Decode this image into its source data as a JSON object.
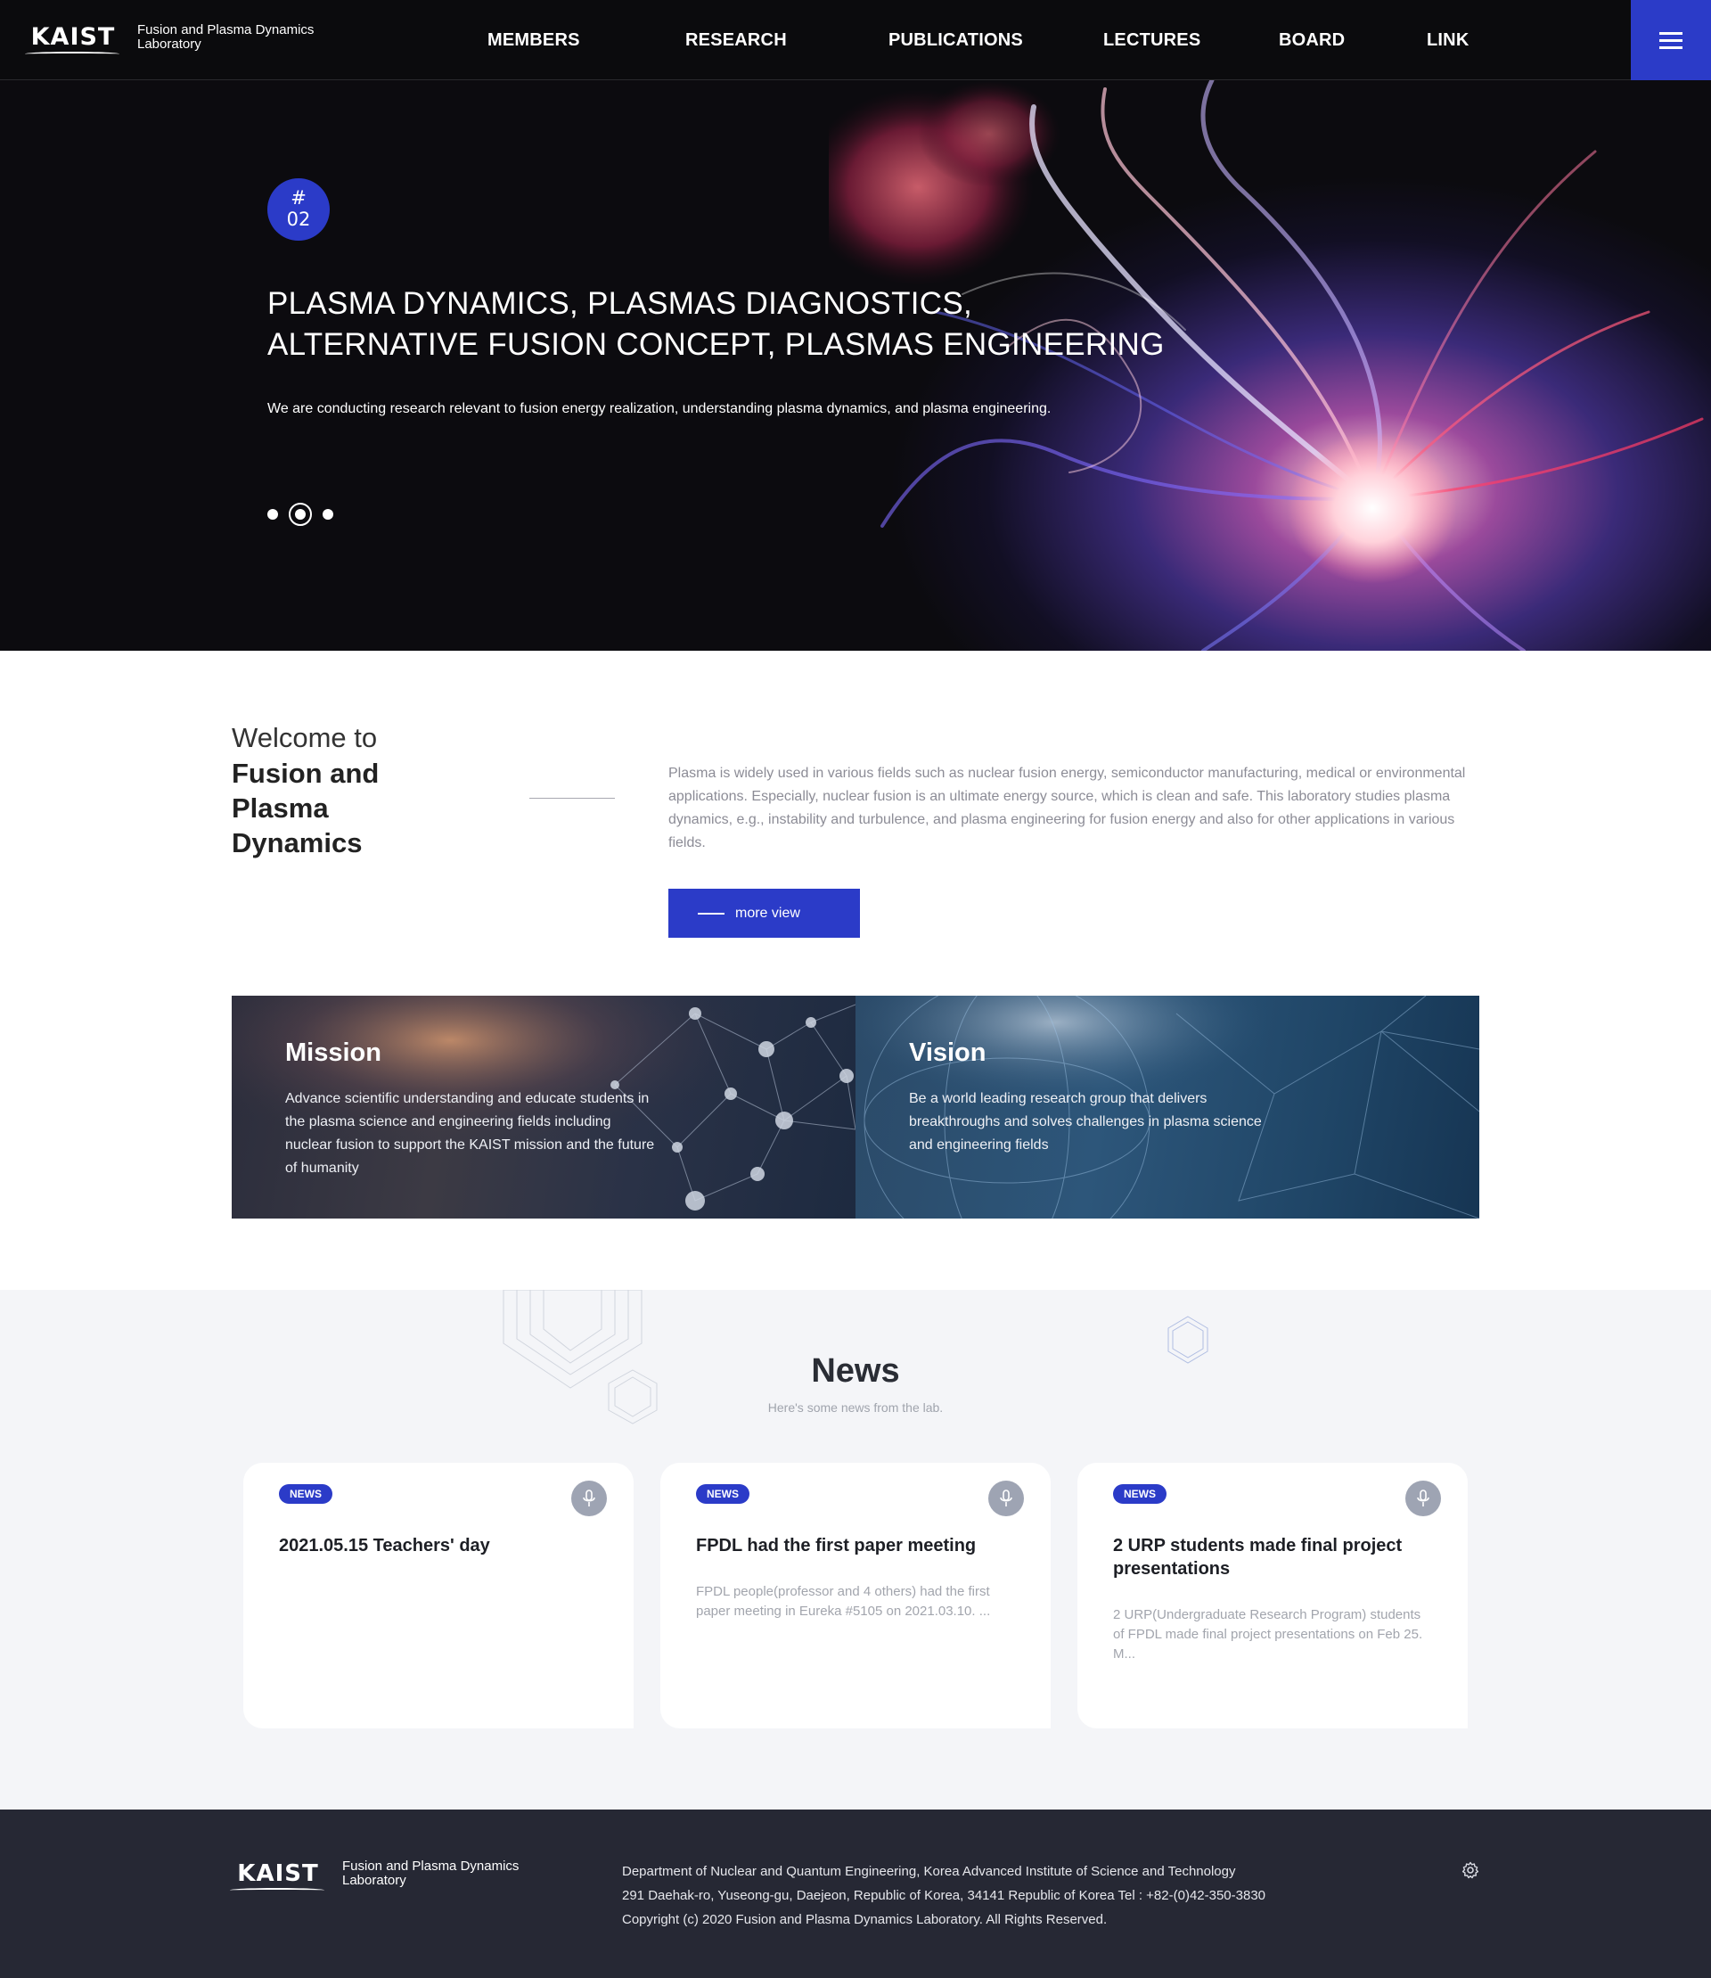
{
  "header": {
    "logo_word": "KAIST",
    "logo_text_line1": "Fusion and Plasma Dynamics",
    "logo_text_line2": "Laboratory",
    "nav": [
      "MEMBERS",
      "RESEARCH",
      "PUBLICATIONS",
      "LECTURES",
      "BOARD",
      "LINK"
    ],
    "menu_icon": "hamburger-icon"
  },
  "hero": {
    "badge_hash": "#",
    "badge_number": "02",
    "title_line1": "PLASMA DYNAMICS, PLASMAS DIAGNOSTICS,",
    "title_line2": "ALTERNATIVE FUSION CONCEPT, PLASMAS ENGINEERING",
    "description": "We are conducting research relevant to fusion energy realization, understanding plasma dynamics, and plasma engineering.",
    "slide_count": 3,
    "active_slide": 2
  },
  "welcome": {
    "pre": "Welcome to",
    "name_line1": "Fusion and",
    "name_line2": "Plasma",
    "name_line3": "Dynamics",
    "text": "Plasma is widely used in various fields such as nuclear fusion energy, semiconductor manufacturing, medical or environmental applications. Especially, nuclear fusion is an ultimate energy source, which is clean and safe. This laboratory studies plasma dynamics, e.g., instability and turbulence, and plasma engineering for fusion energy and also for other applications in various fields.",
    "button_label": "more view"
  },
  "mission": {
    "title": "Mission",
    "text": "Advance scientific understanding and educate students in the plasma science and engineering fields including nuclear fusion to support the KAIST mission and the future of humanity"
  },
  "vision": {
    "title": "Vision",
    "text": "Be a world leading research group that delivers breakthroughs and solves challenges in plasma science and engineering fields"
  },
  "news": {
    "title": "News",
    "subtitle": "Here's some news from the lab.",
    "cards": [
      {
        "tag": "NEWS",
        "title": "2021.05.15 Teachers' day",
        "body": ""
      },
      {
        "tag": "NEWS",
        "title": "FPDL had the first paper meeting",
        "body": "FPDL people(professor and 4 others) had the first paper meeting in Eureka #5105 on 2021.03.10. ..."
      },
      {
        "tag": "NEWS",
        "title": "2 URP students made final project presentations",
        "body": "2 URP(Undergraduate Research Program) students of FPDL made final project presentations on Feb 25. M..."
      }
    ]
  },
  "footer": {
    "logo_word": "KAIST",
    "logo_text_line1": "Fusion and Plasma Dynamics",
    "logo_text_line2": "Laboratory",
    "address_line1": "Department of Nuclear and Quantum Engineering, Korea Advanced Institute of Science and Technology",
    "address_line2": "291 Daehak-ro, Yuseong-gu, Daejeon, Republic of Korea, 34141 Republic of Korea Tel : +82-(0)42-350-3830",
    "copyright": "Copyright (c) 2020 Fusion and Plasma Dynamics Laboratory. All Rights Reserved.",
    "gear_icon": "gear-icon"
  },
  "colors": {
    "accent": "#2b3bc8",
    "header_bg": "#0b0b0d",
    "footer_bg": "#262834",
    "news_bg": "#f4f5f8"
  }
}
